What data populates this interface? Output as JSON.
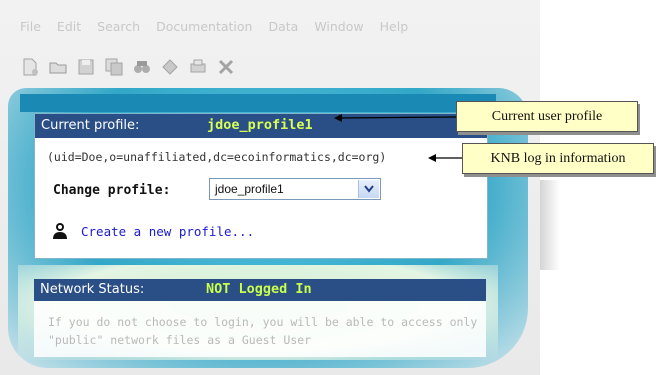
{
  "menubar": {
    "items": [
      "File",
      "Edit",
      "Search",
      "Documentation",
      "Data",
      "Window",
      "Help"
    ]
  },
  "toolbar": {
    "icons": [
      "new-document-icon",
      "open-folder-icon",
      "save-icon",
      "copy-icon",
      "search-binoculars-icon",
      "refresh-icon",
      "print-icon",
      "close-x-icon"
    ]
  },
  "profile": {
    "current_label": "Current profile:",
    "current_value": "jdoe_profile1",
    "uid_line": "(uid=Doe,o=unaffiliated,dc=ecoinformatics,dc=org)",
    "change_label": "Change profile:",
    "selected": "jdoe_profile1",
    "create_link": "Create a new profile..."
  },
  "network": {
    "label": "Network Status:",
    "value": "NOT Logged In",
    "message": "If you do not choose to login, you will be able to access only \"public\" network files as a Guest User"
  },
  "callouts": {
    "user_profile": "Current user profile",
    "login_info": "KNB log in information"
  },
  "colors": {
    "header_bg": "#2a4f86",
    "profile_value": "#d8ff55",
    "link": "#1a1ad0",
    "callout_bg": "#ffffc6"
  }
}
